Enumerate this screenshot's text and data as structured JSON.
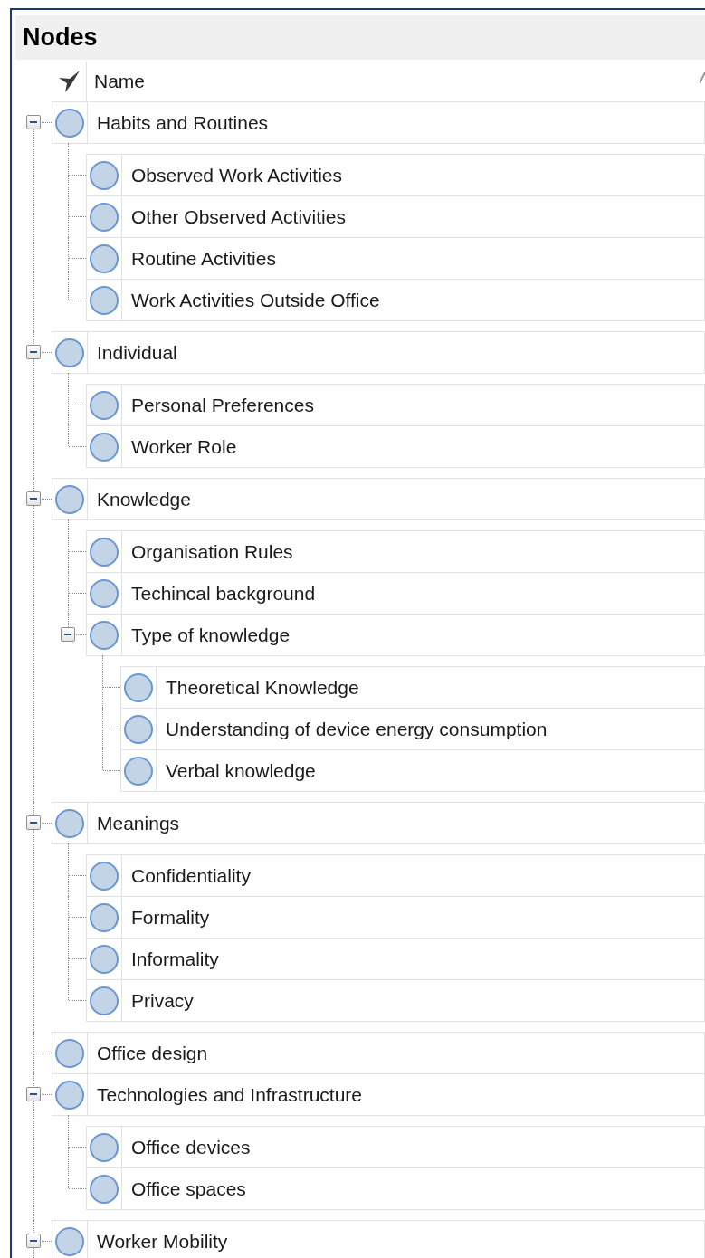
{
  "panel": {
    "title": "Nodes"
  },
  "column_header": {
    "label": "Name"
  },
  "nodes": [
    {
      "label": "Habits and Routines",
      "expanded": true,
      "children": [
        {
          "label": "Observed Work Activities"
        },
        {
          "label": "Other Observed Activities"
        },
        {
          "label": "Routine Activities"
        },
        {
          "label": "Work Activities Outside Office"
        }
      ]
    },
    {
      "label": "Individual",
      "expanded": true,
      "children": [
        {
          "label": "Personal Preferences"
        },
        {
          "label": "Worker Role"
        }
      ]
    },
    {
      "label": "Knowledge",
      "expanded": true,
      "children": [
        {
          "label": "Organisation Rules"
        },
        {
          "label": "Techincal background"
        },
        {
          "label": "Type of knowledge",
          "expanded": true,
          "children": [
            {
              "label": "Theoretical Knowledge"
            },
            {
              "label": "Understanding of device energy consumption"
            },
            {
              "label": "Verbal knowledge"
            }
          ]
        }
      ]
    },
    {
      "label": "Meanings",
      "expanded": true,
      "children": [
        {
          "label": "Confidentiality"
        },
        {
          "label": "Formality"
        },
        {
          "label": "Informality"
        },
        {
          "label": "Privacy"
        }
      ]
    },
    {
      "label": "Office design"
    },
    {
      "label": "Technologies and Infrastructure",
      "expanded": true,
      "children": [
        {
          "label": "Office devices"
        },
        {
          "label": "Office spaces"
        }
      ]
    },
    {
      "label": "Worker Mobility",
      "expanded": true
    }
  ]
}
